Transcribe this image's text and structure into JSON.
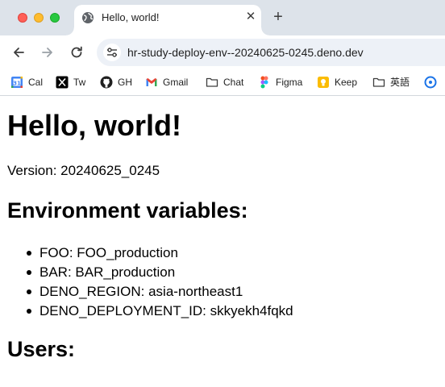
{
  "browser": {
    "tab": {
      "title": "Hello, world!"
    },
    "address_bar": {
      "url": "hr-study-deploy-env--20240625-0245.deno.dev"
    },
    "bookmarks": [
      {
        "label": "Cal",
        "icon": "google-calendar-icon"
      },
      {
        "label": "Tw",
        "icon": "x-twitter-icon"
      },
      {
        "label": "GH",
        "icon": "github-icon"
      },
      {
        "label": "Gmail",
        "icon": "gmail-icon"
      },
      {
        "label": "Chat",
        "icon": "folder-icon"
      },
      {
        "label": "Figma",
        "icon": "figma-icon"
      },
      {
        "label": "Keep",
        "icon": "google-keep-icon"
      },
      {
        "label": "英語",
        "icon": "folder-icon"
      }
    ]
  },
  "page": {
    "heading": "Hello, world!",
    "version_label": "Version:",
    "version_value": "20240625_0245",
    "env_heading": "Environment variables:",
    "env_vars": [
      {
        "name": "FOO",
        "value": "FOO_production"
      },
      {
        "name": "BAR",
        "value": "BAR_production"
      },
      {
        "name": "DENO_REGION",
        "value": "asia-northeast1"
      },
      {
        "name": "DENO_DEPLOYMENT_ID",
        "value": "skkyekh4fqkd"
      }
    ],
    "users_heading": "Users:"
  },
  "colors": {
    "tabstrip_bg": "#dde3ea",
    "omnibox_bg": "#edf1f7",
    "close_light": "#ff5f57",
    "minimize_light": "#febc2e",
    "maximize_light": "#28c840"
  }
}
